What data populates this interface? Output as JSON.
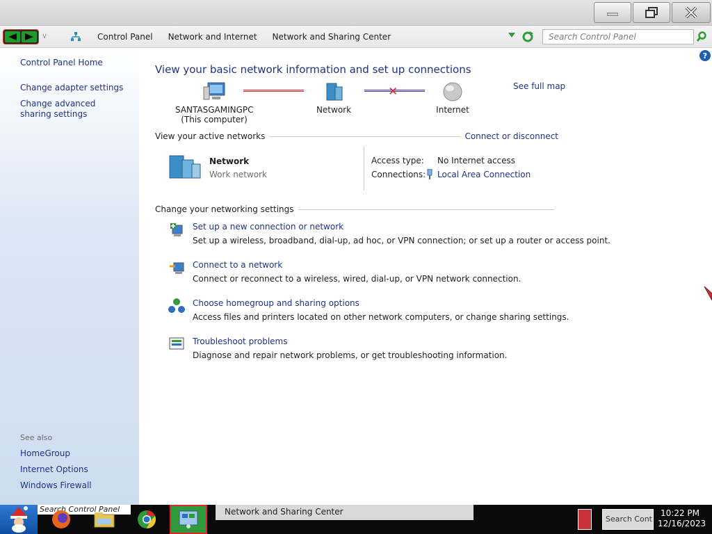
{
  "window": {
    "min_label": "–",
    "max_label": "❐",
    "close_label": "✕"
  },
  "address": {
    "crumbs": [
      "Control Panel",
      "Network and Internet",
      "Network and Sharing Center"
    ],
    "search_placeholder": "Search Control Panel"
  },
  "sidebar": {
    "home": "Control Panel Home",
    "links": [
      "Change adapter settings",
      "Change advanced sharing settings"
    ],
    "see_also_heading": "See also",
    "see_also": [
      "HomeGroup",
      "Internet Options",
      "Windows Firewall"
    ]
  },
  "main": {
    "heading": "View your basic network information and set up connections",
    "see_full_map": "See full map",
    "map": {
      "computer_name": "SANTASGAMINGPC",
      "computer_sub": "(This computer)",
      "network": "Network",
      "internet": "Internet"
    },
    "active_networks": {
      "heading": "View your active networks",
      "connect_link": "Connect or disconnect",
      "network_name": "Network",
      "network_type": "Work network",
      "access_type_label": "Access type:",
      "access_type_value": "No Internet access",
      "connections_label": "Connections:",
      "connections_value": "Local Area Connection"
    },
    "settings": {
      "heading": "Change your networking settings",
      "tasks": [
        {
          "title": "Set up a new connection or network",
          "desc": "Set up a wireless, broadband, dial-up, ad hoc, or VPN connection; or set up a router or access point."
        },
        {
          "title": "Connect to a network",
          "desc": "Connect or reconnect to a wireless, wired, dial-up, or VPN network connection."
        },
        {
          "title": "Choose homegroup and sharing options",
          "desc": "Access files and printers located on other network computers, or change sharing settings."
        },
        {
          "title": "Troubleshoot problems",
          "desc": "Diagnose and repair network problems, or get troubleshooting information."
        }
      ]
    }
  },
  "taskbar": {
    "search_text": "Search Control Panel",
    "active_window": "Network and Sharing Center",
    "tray_text": "Search Contro",
    "time": "10:22 PM",
    "date": "12/16/2023"
  },
  "colors": {
    "link": "#1e3287",
    "sidebar_bg": "#dce6f4",
    "taskbar_bg": "#0a0a0a",
    "disconnected": "#d62a2a"
  },
  "icons": [
    "minimize-icon",
    "maximize-icon",
    "close-icon",
    "back-icon",
    "forward-icon",
    "network-crumb-icon",
    "refresh-icon",
    "search-icon",
    "help-icon",
    "computer-icon",
    "network-icon",
    "internet-globe-icon",
    "server-icon",
    "plug-icon",
    "new-connection-icon",
    "connect-network-icon",
    "homegroup-icon",
    "troubleshoot-icon",
    "santa-start-icon",
    "firefox-icon",
    "explorer-icon",
    "chrome-icon",
    "control-panel-app-icon"
  ]
}
